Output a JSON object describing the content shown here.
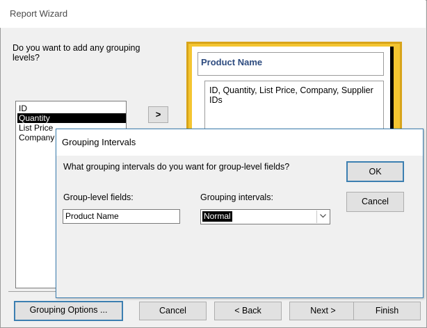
{
  "wizard": {
    "title": "Report Wizard",
    "question": "Do you want to add any grouping levels?",
    "fields": [
      "ID",
      "Quantity",
      "List Price",
      "Company"
    ],
    "selected_field": "Quantity",
    "move_button": ">",
    "preview": {
      "group_header": "Product Name",
      "detail_fields": "ID, Quantity, List Price, Company, Supplier IDs"
    },
    "buttons": {
      "grouping_options": "Grouping Options ...",
      "cancel": "Cancel",
      "back": "< Back",
      "next": "Next >",
      "finish": "Finish"
    }
  },
  "dialog": {
    "title": "Grouping Intervals",
    "question": "What grouping intervals do you want for group-level fields?",
    "group_fields_label": "Group-level fields:",
    "intervals_label": "Grouping intervals:",
    "group_field_value": "Product Name",
    "interval_value": "Normal",
    "ok_label": "OK",
    "cancel_label": "Cancel"
  },
  "colors": {
    "accent_border": "#3c7fb1",
    "preview_frame": "#f4c531",
    "preview_header_text": "#2d4b7f"
  },
  "icons": {
    "dropdown": "chevron-down-icon"
  }
}
